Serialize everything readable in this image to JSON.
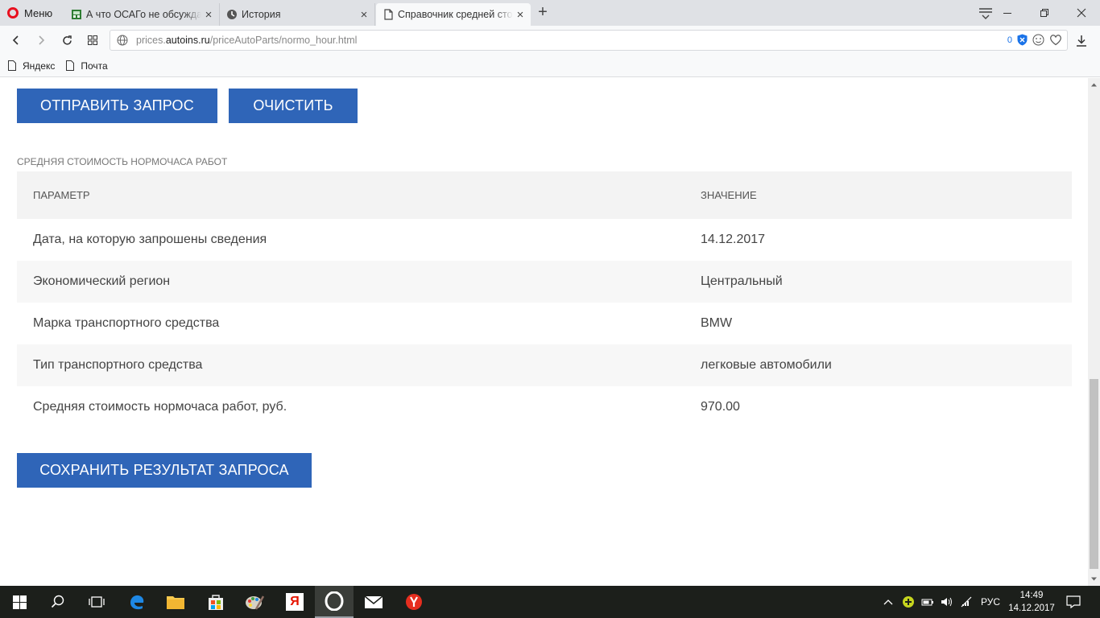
{
  "browser": {
    "menu_label": "Меню",
    "tabs": [
      {
        "title": "А что ОСАГо не обсуждается",
        "close": "×"
      },
      {
        "title": "История",
        "close": "×"
      },
      {
        "title": "Справочник средней стоимости нормочаса",
        "close": "×"
      }
    ],
    "newtab_label": "+",
    "url_prefix": "prices.",
    "url_host": "autoins.ru",
    "url_path": "/priceAutoParts/normo_hour.html",
    "adblock_count": "0",
    "bookmarks": [
      {
        "label": "Яндекс"
      },
      {
        "label": "Почта"
      }
    ]
  },
  "page": {
    "send_button": "ОТПРАВИТЬ ЗАПРОС",
    "clear_button": "ОЧИСТИТЬ",
    "section_title": "СРЕДНЯЯ СТОИМОСТЬ НОРМОЧАСА РАБОТ",
    "table": {
      "headers": [
        "ПАРАМЕТР",
        "ЗНАЧЕНИЕ"
      ],
      "rows": [
        {
          "param": "Дата, на которую запрошены сведения",
          "value": "14.12.2017"
        },
        {
          "param": "Экономический регион",
          "value": "Центральный"
        },
        {
          "param": "Марка транспортного средства",
          "value": "BMW"
        },
        {
          "param": "Тип транспортного средства",
          "value": "легковые автомобили"
        },
        {
          "param": "Средняя стоимость нормочаса работ, руб.",
          "value": "970.00"
        }
      ]
    },
    "save_button": "СОХРАНИТЬ РЕЗУЛЬТАТ ЗАПРОСА"
  },
  "taskbar": {
    "language": "РУС",
    "time": "14:49",
    "date": "14.12.2017",
    "yandex_letter": "Я"
  },
  "colors": {
    "button_blue": "#2f65b8",
    "opera_red": "#e8101f",
    "taskbar": "#1c1f1b"
  },
  "icons": [
    "opera-logo-icon",
    "tab-favicon-icon",
    "history-icon",
    "page-icon",
    "back-icon",
    "forward-icon",
    "reload-icon",
    "speed-dial-icon",
    "globe-icon",
    "adblock-icon",
    "emoji-icon",
    "heart-icon",
    "download-icon",
    "windows-start-icon",
    "search-icon",
    "task-view-icon",
    "edge-icon",
    "explorer-icon",
    "store-icon",
    "paint-icon",
    "yandex-icon",
    "opera-icon",
    "mail-icon",
    "yandex-browser-icon",
    "notification-icon"
  ]
}
